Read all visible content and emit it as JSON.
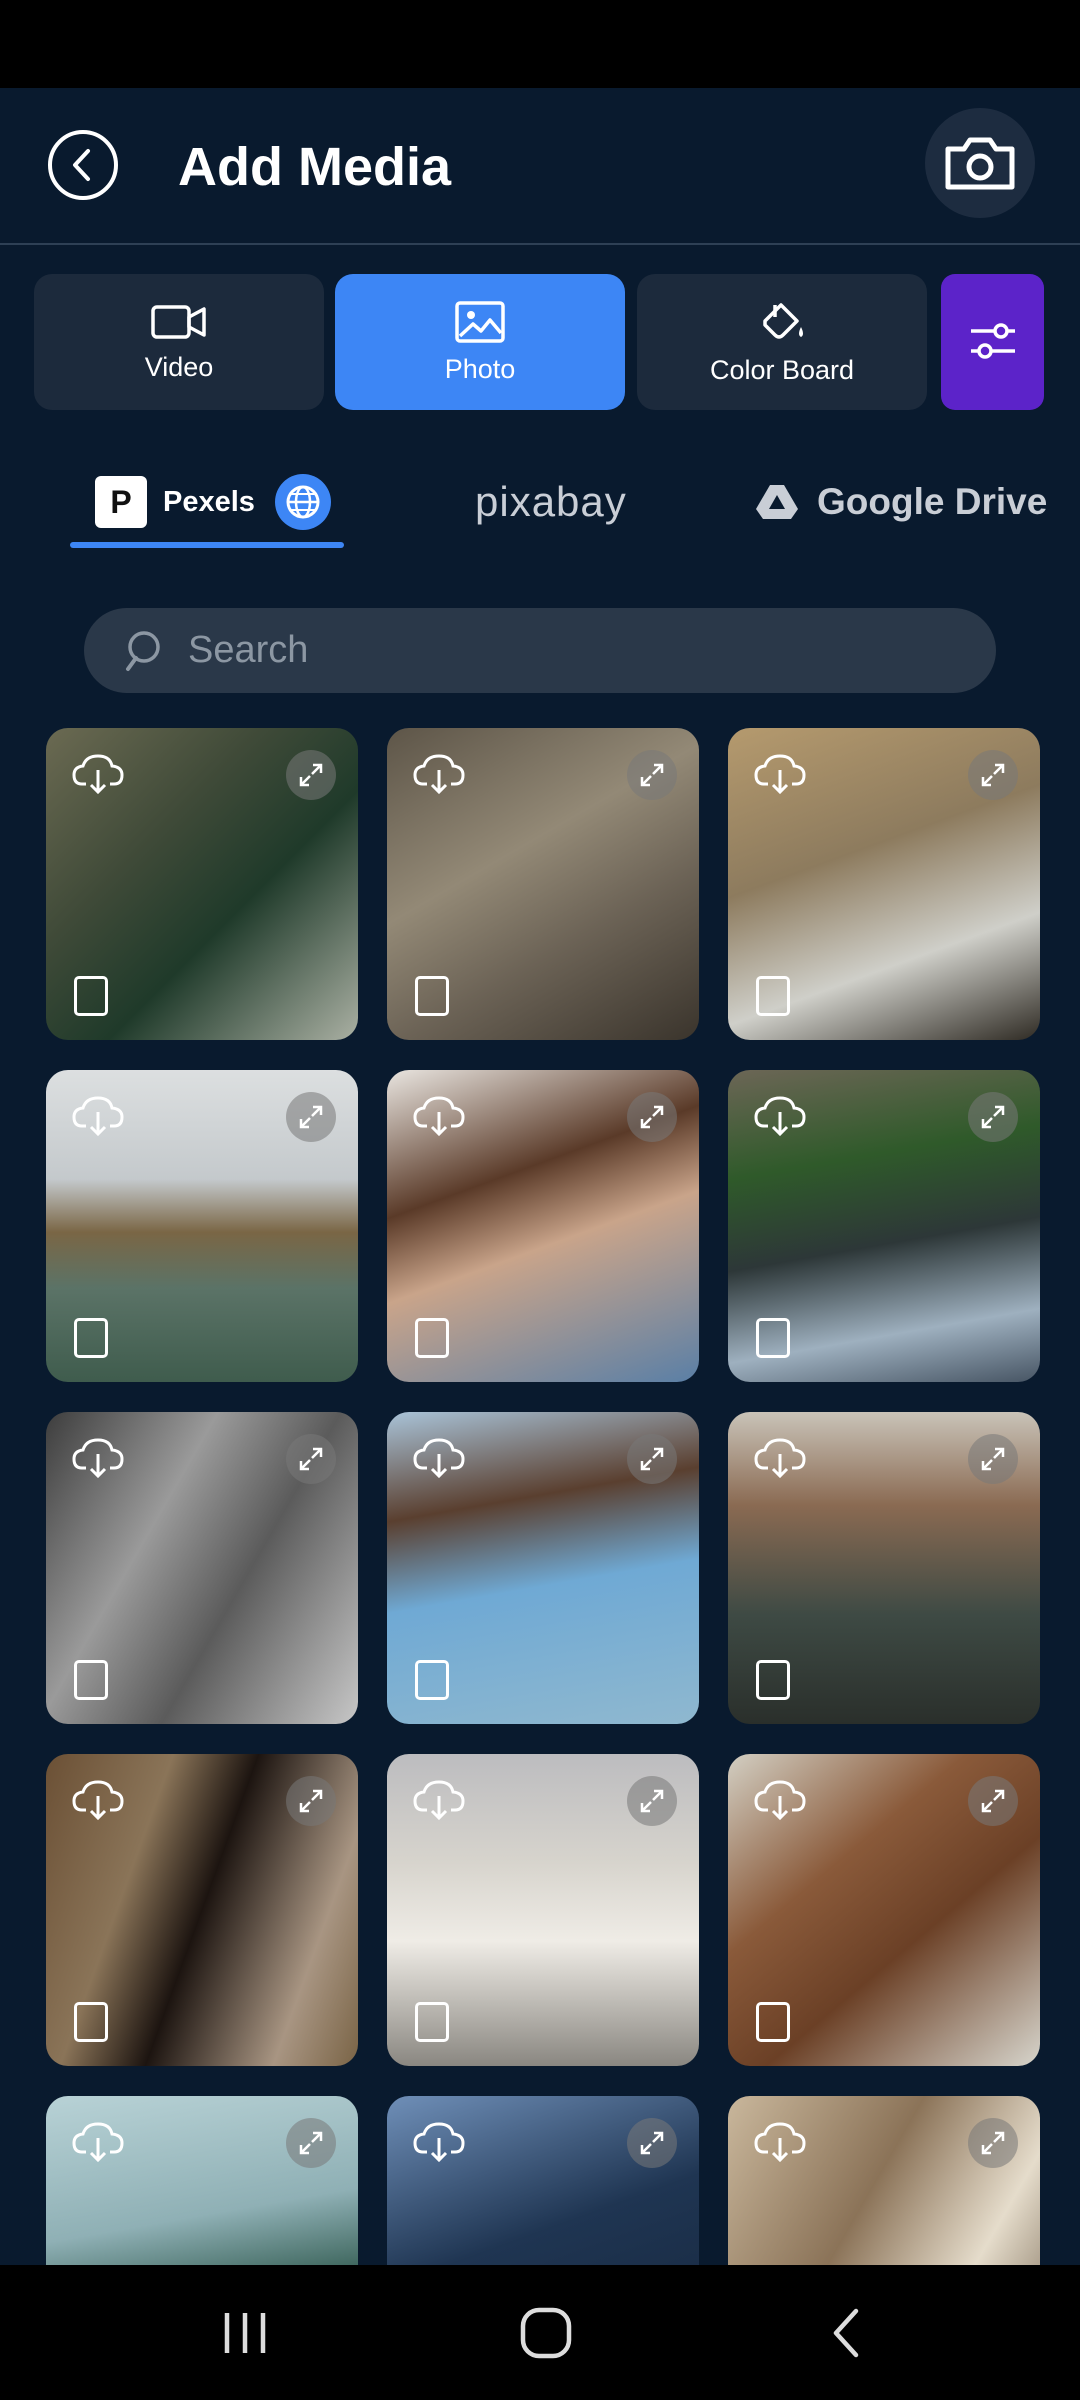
{
  "header": {
    "title": "Add Media"
  },
  "tabs": [
    {
      "label": "Video",
      "icon": "video-camera-icon"
    },
    {
      "label": "Photo",
      "icon": "image-icon",
      "active": true
    },
    {
      "label": "Color Board",
      "icon": "paint-bucket-icon"
    }
  ],
  "sources": {
    "pexels": "Pexels",
    "pixabay": "pixabay",
    "drive": "Google Drive"
  },
  "search": {
    "placeholder": "Search"
  },
  "colors": {
    "background": "#091a2e",
    "accent": "#3d86f5",
    "filter": "#5c23c9",
    "tab": "#1c2a3c"
  },
  "tiles": [
    {
      "name": "photo-man-green-sweater"
    },
    {
      "name": "photo-rock-cliff"
    },
    {
      "name": "photo-lizard"
    },
    {
      "name": "photo-sea-coast"
    },
    {
      "name": "photo-woman-hair"
    },
    {
      "name": "photo-woman-waterfall"
    },
    {
      "name": "photo-street-bw"
    },
    {
      "name": "photo-woman-sea"
    },
    {
      "name": "photo-venice-canal"
    },
    {
      "name": "photo-woman-profile"
    },
    {
      "name": "photo-tower-building"
    },
    {
      "name": "photo-deer"
    },
    {
      "name": "photo-street-sign"
    },
    {
      "name": "photo-skyscraper"
    },
    {
      "name": "photo-doorway"
    }
  ]
}
